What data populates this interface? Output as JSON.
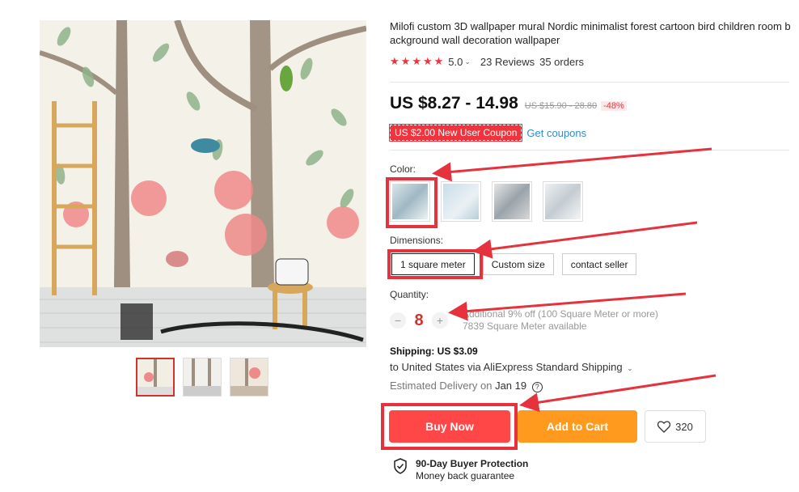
{
  "product": {
    "title": "Milofi custom 3D wallpaper mural Nordic minimalist forest cartoon bird children room background wall decoration wallpaper",
    "rating": "5.0",
    "reviews": "23 Reviews",
    "orders": "35 orders",
    "price": "US $8.27 - 14.98",
    "old_price": "US $15.90 - 28.80",
    "discount": "-48%"
  },
  "coupon": {
    "badge": "US $2.00 New User Coupon",
    "link": "Get coupons"
  },
  "color": {
    "label": "Color:",
    "selected_index": 0
  },
  "dimensions": {
    "label": "Dimensions:",
    "options": [
      "1 square meter",
      "Custom size",
      "contact seller"
    ],
    "selected_index": 0
  },
  "quantity": {
    "label": "Quantity:",
    "minus": "−",
    "value": "8",
    "plus": "+",
    "extra_discount": "Additional 9% off (100 Square Meter or more)",
    "available": "7839 Square Meter available"
  },
  "shipping": {
    "title": "Shipping: US $3.09",
    "via": "to United States via AliExpress Standard Shipping",
    "delivery_prefix": "Estimated Delivery on",
    "delivery_date": "Jan 19"
  },
  "actions": {
    "buy_now": "Buy Now",
    "add_to_cart": "Add to Cart",
    "wishlist_count": "320"
  },
  "protection": {
    "title": "90-Day Buyer Protection",
    "subtitle": "Money back guarantee"
  },
  "colors": {
    "accent": "#ff4747",
    "cart": "#ff9a1f",
    "annotation": "#e5323c",
    "link": "#2f8dc9"
  },
  "icons": [
    "star-icon",
    "chevron-down-icon",
    "info-icon",
    "heart-icon",
    "shield-check-icon"
  ]
}
